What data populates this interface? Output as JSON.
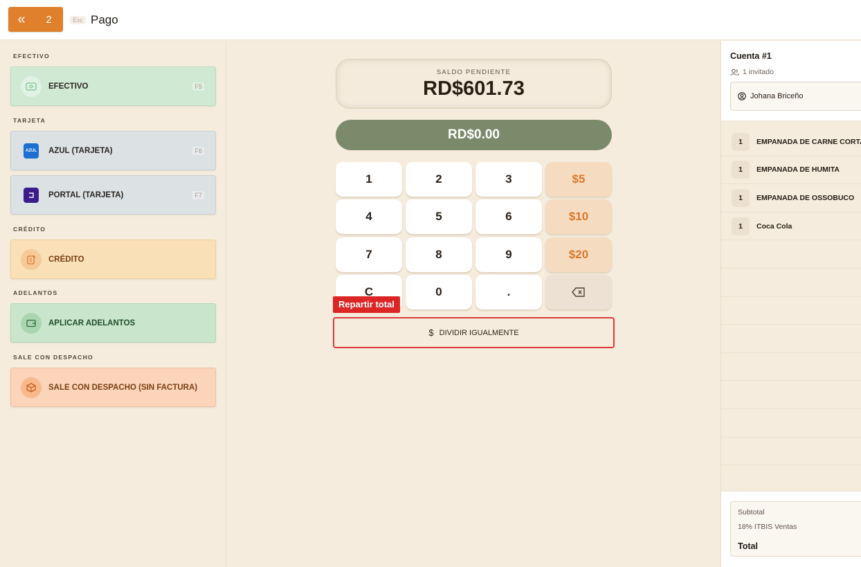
{
  "header": {
    "back_count": "2",
    "esc_hint": "Esc",
    "title": "Pago"
  },
  "payment_methods": {
    "sections": {
      "efectivo": "EFECTIVO",
      "tarjeta": "TARJETA",
      "credito": "CRÉDITO",
      "adelantos": "ADELANTOS",
      "despacho": "SALE CON DESPACHO"
    },
    "efectivo": {
      "label": "EFECTIVO",
      "key": "F5",
      "icon": "cash-icon"
    },
    "azul": {
      "label": "AZUL (TARJETA)",
      "key": "F6",
      "icon": "azul-logo",
      "logo_text": "AZUL"
    },
    "portal": {
      "label": "PORTAL (TARJETA)",
      "key": "F7",
      "icon": "portal-logo"
    },
    "credito": {
      "label": "CRÉDITO",
      "icon": "credit-note-icon"
    },
    "adelantos": {
      "label": "APLICAR ADELANTOS",
      "icon": "wallet-icon"
    },
    "despacho": {
      "label": "SALE CON DESPACHO (SIN FACTURA)",
      "icon": "package-icon"
    }
  },
  "center": {
    "balance_label": "SALDO PENDIENTE",
    "balance_amount": "RD$601.73",
    "entry_amount": "RD$0.00",
    "keypad": [
      "1",
      "2",
      "3",
      "$5",
      "4",
      "5",
      "6",
      "$10",
      "7",
      "8",
      "9",
      "$20",
      "C",
      "0",
      "."
    ],
    "split_tooltip": "Repartir total",
    "split_label": "DIVIDIR IGUALMENTE",
    "colors": {
      "accent": "#e07f2c",
      "entry_bar": "#7b8a6a",
      "danger": "#dc2626"
    }
  },
  "account": {
    "title": "Cuenta #1",
    "guests": "1 invitado",
    "guest_name": "Johana Briceño",
    "items": [
      {
        "qty": "1",
        "name": "EMPANADA DE CARNE CORTADA"
      },
      {
        "qty": "1",
        "name": "EMPANADA DE HUMITA"
      },
      {
        "qty": "1",
        "name": "EMPANADA DE OSSOBUCO"
      },
      {
        "qty": "1",
        "name": "Coca Cola"
      }
    ],
    "subtotal_label": "Subtotal",
    "tax_label": "18% ITBIS Ventas",
    "total_label": "Total"
  }
}
